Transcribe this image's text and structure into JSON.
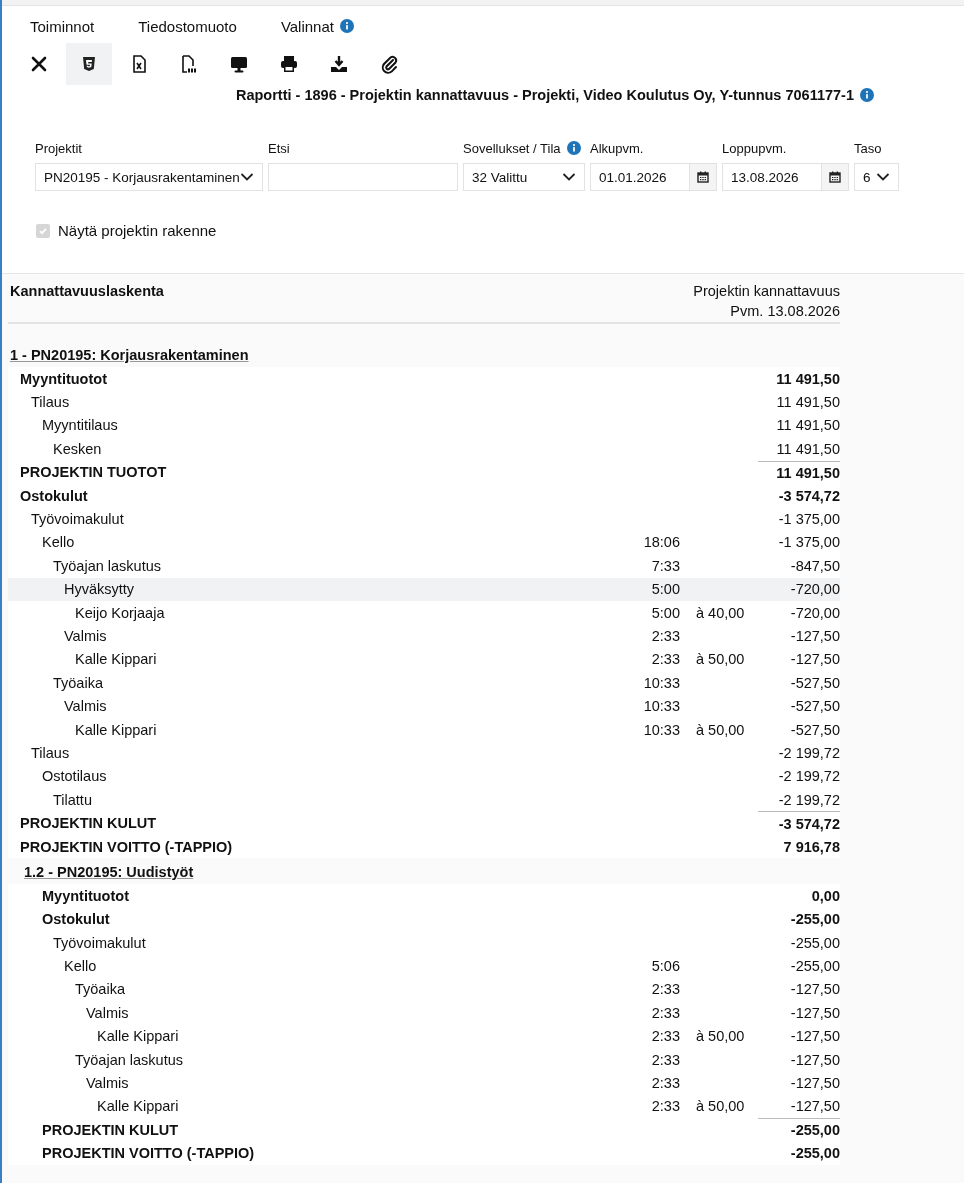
{
  "menu": [
    {
      "label": "Toiminnot",
      "info": false
    },
    {
      "label": "Tiedostomuoto",
      "info": false
    },
    {
      "label": "Valinnat",
      "info": true
    }
  ],
  "toolbar": [
    {
      "selected": false
    },
    {
      "selected": true
    },
    {
      "selected": false
    },
    {
      "selected": false
    },
    {
      "selected": false
    },
    {
      "selected": false
    },
    {
      "selected": false
    },
    {
      "selected": false
    }
  ],
  "report_title": "Raportti - 1896 - Projektin kannattavuus - Projekti, Video Koulutus Oy, Y-tunnus 7061177-1",
  "filters": [
    {
      "kind": "select",
      "label": "Projektit",
      "info": false,
      "value": "PN20195 - Korjausrakentaminen"
    },
    {
      "kind": "text",
      "label": "Etsi",
      "info": false
    },
    {
      "kind": "select",
      "label": "Sovellukset / Tila",
      "info": true,
      "value": "32 Valittu"
    },
    {
      "kind": "date",
      "label": "Alkupvm.",
      "info": false,
      "value": "01.01.2026"
    },
    {
      "kind": "date",
      "label": "Loppupvm.",
      "info": false,
      "value": "13.08.2026"
    },
    {
      "kind": "select",
      "label": "Taso",
      "info": false,
      "value": "6"
    }
  ],
  "structure_checkbox": {
    "label": "Näytä projektin rakenne",
    "checked": true
  },
  "report": {
    "heading": "Kannattavuuslaskenta",
    "subtitle": "Projektin kannattavuus",
    "date": "Pvm. 13.08.2026",
    "projects": [
      {
        "title": "1 - PN20195: Korjausrakentaminen",
        "rows": [
          {
            "kind": "group",
            "label": "Myyntituotot",
            "amount": "11 491,50",
            "selected": false,
            "children": [
              {
                "kind": "line",
                "label": "Tilaus",
                "amount": "11 491,50",
                "selected": false,
                "children": [
                  {
                    "kind": "line",
                    "label": "Myyntitilaus",
                    "amount": "11 491,50",
                    "selected": false,
                    "children": [
                      {
                        "kind": "line",
                        "label": "Kesken",
                        "amount": "11 491,50",
                        "selected": false
                      }
                    ]
                  }
                ]
              }
            ]
          },
          {
            "kind": "total",
            "label": "PROJEKTIN TUOTOT",
            "amount": "11 491,50",
            "selected": false
          },
          {
            "kind": "group",
            "label": "Ostokulut",
            "amount": "-3 574,72",
            "selected": false,
            "children": [
              {
                "kind": "line",
                "label": "Työvoimakulut",
                "amount": "-1 375,00",
                "selected": false,
                "children": [
                  {
                    "kind": "line",
                    "label": "Kello",
                    "time": "18:06",
                    "amount": "-1 375,00",
                    "selected": false,
                    "children": [
                      {
                        "kind": "line",
                        "label": "Työajan laskutus",
                        "time": "7:33",
                        "amount": "-847,50",
                        "selected": false,
                        "children": [
                          {
                            "kind": "line",
                            "label": "Hyväksytty",
                            "time": "5:00",
                            "amount": "-720,00",
                            "selected": true,
                            "children": [
                              {
                                "kind": "line",
                                "label": "Keijo Korjaaja",
                                "time": "5:00",
                                "rate": "à 40,00",
                                "amount": "-720,00",
                                "selected": false
                              }
                            ]
                          },
                          {
                            "kind": "line",
                            "label": "Valmis",
                            "time": "2:33",
                            "amount": "-127,50",
                            "selected": false,
                            "children": [
                              {
                                "kind": "line",
                                "label": "Kalle Kippari",
                                "time": "2:33",
                                "rate": "à 50,00",
                                "amount": "-127,50",
                                "selected": false
                              }
                            ]
                          }
                        ]
                      },
                      {
                        "kind": "line",
                        "label": "Työaika",
                        "time": "10:33",
                        "amount": "-527,50",
                        "selected": false,
                        "children": [
                          {
                            "kind": "line",
                            "label": "Valmis",
                            "time": "10:33",
                            "amount": "-527,50",
                            "selected": false,
                            "children": [
                              {
                                "kind": "line",
                                "label": "Kalle Kippari",
                                "time": "10:33",
                                "rate": "à 50,00",
                                "amount": "-527,50",
                                "selected": false
                              }
                            ]
                          }
                        ]
                      }
                    ]
                  }
                ]
              },
              {
                "kind": "line",
                "label": "Tilaus",
                "amount": "-2 199,72",
                "selected": false,
                "children": [
                  {
                    "kind": "line",
                    "label": "Ostotilaus",
                    "amount": "-2 199,72",
                    "selected": false,
                    "children": [
                      {
                        "kind": "line",
                        "label": "Tilattu",
                        "amount": "-2 199,72",
                        "selected": false
                      }
                    ]
                  }
                ]
              }
            ]
          },
          {
            "kind": "total",
            "label": "PROJEKTIN KULUT",
            "amount": "-3 574,72",
            "selected": false
          },
          {
            "kind": "group",
            "label": "PROJEKTIN VOITTO (-TAPPIO)",
            "amount": "7 916,78",
            "selected": false
          }
        ],
        "subprojects": [
          {
            "title": "1.2 - PN20195: Uudistyöt",
            "rows": [
              {
                "kind": "group",
                "label": "Myyntituotot",
                "amount": "0,00",
                "selected": false
              },
              {
                "kind": "group",
                "label": "Ostokulut",
                "amount": "-255,00",
                "selected": false,
                "children": [
                  {
                    "kind": "line",
                    "label": "Työvoimakulut",
                    "amount": "-255,00",
                    "selected": false,
                    "children": [
                      {
                        "kind": "line",
                        "label": "Kello",
                        "time": "5:06",
                        "amount": "-255,00",
                        "selected": false,
                        "children": [
                          {
                            "kind": "line",
                            "label": "Työaika",
                            "time": "2:33",
                            "amount": "-127,50",
                            "selected": false,
                            "children": [
                              {
                                "kind": "line",
                                "label": "Valmis",
                                "time": "2:33",
                                "amount": "-127,50",
                                "selected": false,
                                "children": [
                                  {
                                    "kind": "line",
                                    "label": "Kalle Kippari",
                                    "time": "2:33",
                                    "rate": "à 50,00",
                                    "amount": "-127,50",
                                    "selected": false
                                  }
                                ]
                              }
                            ]
                          },
                          {
                            "kind": "line",
                            "label": "Työajan laskutus",
                            "time": "2:33",
                            "amount": "-127,50",
                            "selected": false,
                            "children": [
                              {
                                "kind": "line",
                                "label": "Valmis",
                                "time": "2:33",
                                "amount": "-127,50",
                                "selected": false,
                                "children": [
                                  {
                                    "kind": "line",
                                    "label": "Kalle Kippari",
                                    "time": "2:33",
                                    "rate": "à 50,00",
                                    "amount": "-127,50",
                                    "selected": false
                                  }
                                ]
                              }
                            ]
                          }
                        ]
                      }
                    ]
                  }
                ]
              },
              {
                "kind": "total",
                "label": "PROJEKTIN KULUT",
                "amount": "-255,00",
                "selected": false
              },
              {
                "kind": "group",
                "label": "PROJEKTIN VOITTO (-TAPPIO)",
                "amount": "-255,00",
                "selected": false
              }
            ]
          }
        ]
      }
    ]
  }
}
